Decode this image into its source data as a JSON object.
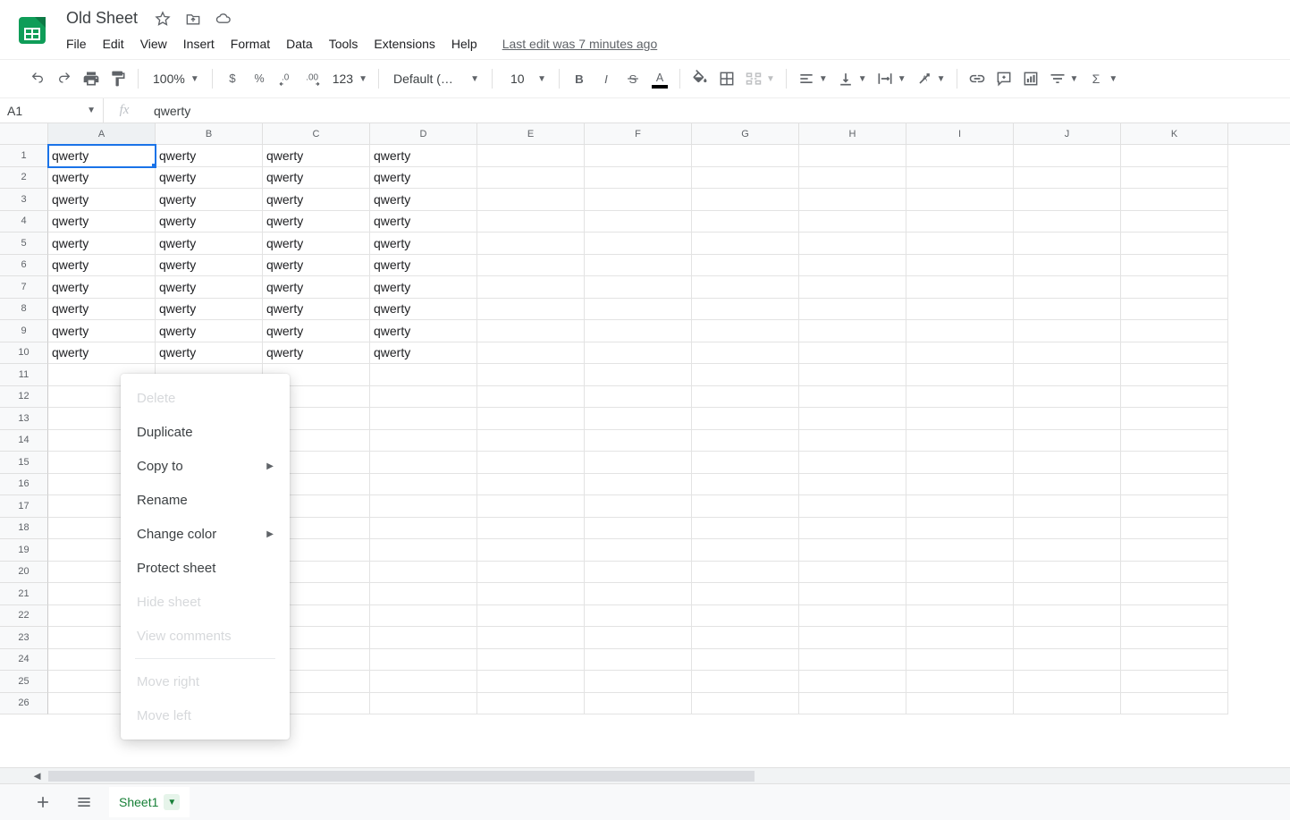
{
  "doc": {
    "title": "Old Sheet"
  },
  "menus": [
    "File",
    "Edit",
    "View",
    "Insert",
    "Format",
    "Data",
    "Tools",
    "Extensions",
    "Help"
  ],
  "last_edit": "Last edit was 7 minutes ago",
  "toolbar": {
    "zoom": "100%",
    "format123": "123",
    "font": "Default (Ari...",
    "font_size": "10"
  },
  "name_box": "A1",
  "formula": "qwerty",
  "columns": [
    "A",
    "B",
    "C",
    "D",
    "E",
    "F",
    "G",
    "H",
    "I",
    "J",
    "K"
  ],
  "row_count": 26,
  "filled_rows": 10,
  "filled_cols": 4,
  "cell_value": "qwerty",
  "sheet_tab": {
    "label": "Sheet1"
  },
  "context_menu": {
    "delete": "Delete",
    "duplicate": "Duplicate",
    "copy_to": "Copy to",
    "rename": "Rename",
    "change_color": "Change color",
    "protect": "Protect sheet",
    "hide": "Hide sheet",
    "view_comments": "View comments",
    "move_right": "Move right",
    "move_left": "Move left"
  }
}
